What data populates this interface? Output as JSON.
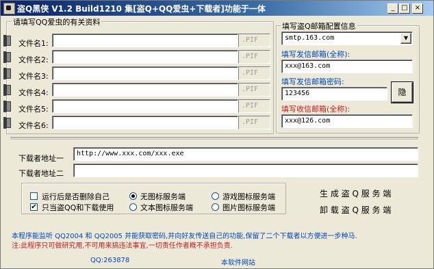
{
  "window": {
    "title": "盗Q黑侠 V1.2 Build1210  集[盗Q+QQ爱虫+下载者]功能于一体",
    "min": "_",
    "max": "□",
    "close": "×"
  },
  "info_group": {
    "label": "请填写QQ爱虫的有关资料",
    "files": [
      {
        "label": "文件名1:",
        "value": "",
        "ext": ".PIF"
      },
      {
        "label": "文件名2:",
        "value": "",
        "ext": ".PIF"
      },
      {
        "label": "文件名3:",
        "value": "",
        "ext": ".PIF"
      },
      {
        "label": "文件名4:",
        "value": "",
        "ext": ".PIF"
      },
      {
        "label": "文件名5:",
        "value": "",
        "ext": ".PIF"
      },
      {
        "label": "文件名6:",
        "value": "",
        "ext": ".PIF"
      }
    ]
  },
  "mail_group": {
    "label": "填写盗Q邮箱配置信息",
    "smtp_value": "smtp.163.com",
    "sender_label": "填写发信邮箱(全称):",
    "sender_value": "xxx@163.com",
    "password_label": "填写发信邮箱密码:",
    "password_value": "123456",
    "hide_button": "隐",
    "receiver_label": "填写收信邮箱(全称):",
    "receiver_value": "xxx@126.com"
  },
  "downloader": {
    "url1_label": "下载者地址一",
    "url1_value": "http://www.xxx.com/xxx.exe",
    "url2_label": "下载者地址二",
    "url2_value": ""
  },
  "options": {
    "delete_self": "运行后是否删除自己",
    "only_steal": "只当盗QQ和下载使用",
    "no_icon": "无图标服务端",
    "text_icon": "文本图标服务端",
    "game_icon": "游戏图标服务端",
    "pic_icon": "图片图标服务端"
  },
  "actions": {
    "generate": "生 成 盗 Q 服 务 端",
    "uninstall": "卸 载 盗 Q 服 务 端"
  },
  "notes": {
    "line1": "本程序能监听 QQ2004 和 QQ2005 并能获取密码,并向好友传送自己的功能,保留了二个下载者以方便进一步种马.",
    "line2": "注:此程序只可做研究用,不可用来搞违法事宜,一切责任作者概不承担负责."
  },
  "footer": {
    "qq": "QQ:263878",
    "website": "本软件网站"
  }
}
